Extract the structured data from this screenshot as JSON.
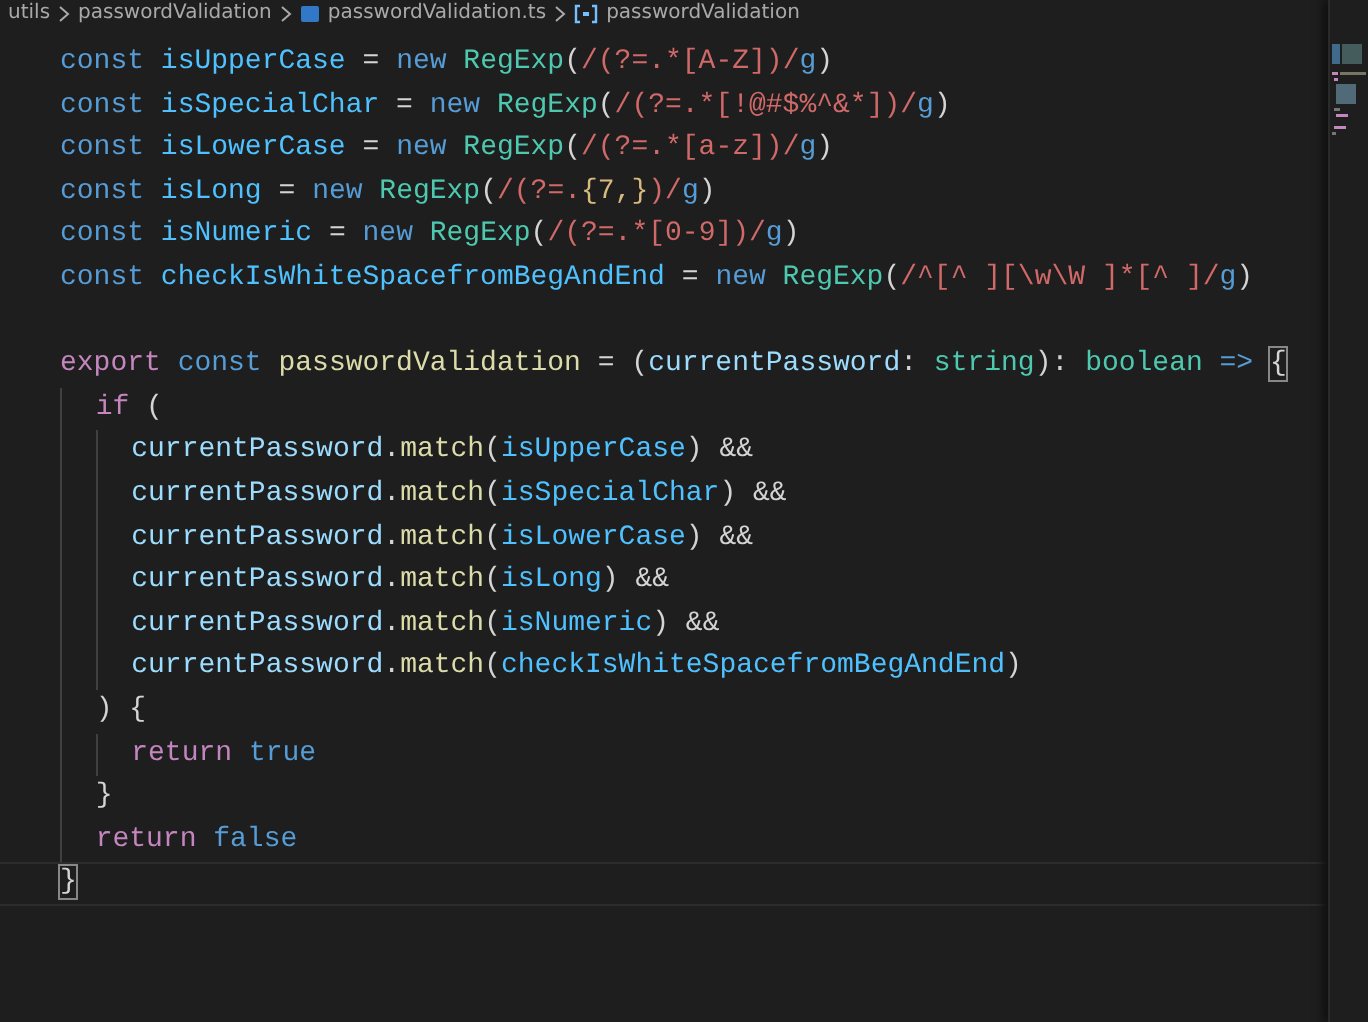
{
  "breadcrumbs": [
    {
      "kind": "folder",
      "label": "utils"
    },
    {
      "kind": "folder",
      "label": "passwordValidation"
    },
    {
      "kind": "file",
      "label": "passwordValidation.ts"
    },
    {
      "kind": "symbol",
      "label": "passwordValidation"
    }
  ],
  "code_lines": [
    {
      "current": false,
      "tokens": [
        {
          "kind": "kw",
          "text": "const "
        },
        {
          "kind": "const",
          "text": "isUpperCase"
        },
        {
          "kind": "plain",
          "text": " = "
        },
        {
          "kind": "kw",
          "text": "new "
        },
        {
          "kind": "type",
          "text": "RegExp"
        },
        {
          "kind": "plain",
          "text": "("
        },
        {
          "kind": "regex",
          "text": "/(?=.*[A-Z])/"
        },
        {
          "kind": "kw",
          "text": "g"
        },
        {
          "kind": "plain",
          "text": ")"
        }
      ]
    },
    {
      "current": false,
      "tokens": [
        {
          "kind": "kw",
          "text": "const "
        },
        {
          "kind": "const",
          "text": "isSpecialChar"
        },
        {
          "kind": "plain",
          "text": " = "
        },
        {
          "kind": "kw",
          "text": "new "
        },
        {
          "kind": "type",
          "text": "RegExp"
        },
        {
          "kind": "plain",
          "text": "("
        },
        {
          "kind": "regex",
          "text": "/(?=.*[!@#$%^&*])/"
        },
        {
          "kind": "kw",
          "text": "g"
        },
        {
          "kind": "plain",
          "text": ")"
        }
      ]
    },
    {
      "current": false,
      "tokens": [
        {
          "kind": "kw",
          "text": "const "
        },
        {
          "kind": "const",
          "text": "isLowerCase"
        },
        {
          "kind": "plain",
          "text": " = "
        },
        {
          "kind": "kw",
          "text": "new "
        },
        {
          "kind": "type",
          "text": "RegExp"
        },
        {
          "kind": "plain",
          "text": "("
        },
        {
          "kind": "regex",
          "text": "/(?=.*[a-z])/"
        },
        {
          "kind": "kw",
          "text": "g"
        },
        {
          "kind": "plain",
          "text": ")"
        }
      ]
    },
    {
      "current": false,
      "tokens": [
        {
          "kind": "kw",
          "text": "const "
        },
        {
          "kind": "const",
          "text": "isLong"
        },
        {
          "kind": "plain",
          "text": " = "
        },
        {
          "kind": "kw",
          "text": "new "
        },
        {
          "kind": "type",
          "text": "RegExp"
        },
        {
          "kind": "plain",
          "text": "("
        },
        {
          "kind": "regex",
          "text": "/(?=."
        },
        {
          "kind": "quant",
          "text": "{7,}"
        },
        {
          "kind": "regex",
          "text": ")/"
        },
        {
          "kind": "kw",
          "text": "g"
        },
        {
          "kind": "plain",
          "text": ")"
        }
      ]
    },
    {
      "current": false,
      "tokens": [
        {
          "kind": "kw",
          "text": "const "
        },
        {
          "kind": "const",
          "text": "isNumeric"
        },
        {
          "kind": "plain",
          "text": " = "
        },
        {
          "kind": "kw",
          "text": "new "
        },
        {
          "kind": "type",
          "text": "RegExp"
        },
        {
          "kind": "plain",
          "text": "("
        },
        {
          "kind": "regex",
          "text": "/(?=.*[0-9])/"
        },
        {
          "kind": "kw",
          "text": "g"
        },
        {
          "kind": "plain",
          "text": ")"
        }
      ]
    },
    {
      "current": false,
      "tokens": [
        {
          "kind": "kw",
          "text": "const "
        },
        {
          "kind": "const",
          "text": "checkIsWhiteSpacefromBegAndEnd"
        },
        {
          "kind": "plain",
          "text": " = "
        },
        {
          "kind": "kw",
          "text": "new "
        },
        {
          "kind": "type",
          "text": "RegExp"
        },
        {
          "kind": "plain",
          "text": "("
        },
        {
          "kind": "regex",
          "text": "/^[^ ][\\w\\W ]*[^ ]/"
        },
        {
          "kind": "kw",
          "text": "g"
        },
        {
          "kind": "plain",
          "text": ")"
        }
      ]
    },
    {
      "current": false
    },
    {
      "current": false,
      "tokens": [
        {
          "kind": "ctrl",
          "text": "export "
        },
        {
          "kind": "kw",
          "text": "const "
        },
        {
          "kind": "fn",
          "text": "passwordValidation"
        },
        {
          "kind": "plain",
          "text": " = ("
        },
        {
          "kind": "var",
          "text": "currentPassword"
        },
        {
          "kind": "plain",
          "text": ": "
        },
        {
          "kind": "type",
          "text": "string"
        },
        {
          "kind": "plain",
          "text": "): "
        },
        {
          "kind": "type",
          "text": "boolean "
        },
        {
          "kind": "kw",
          "text": "=> "
        },
        {
          "kind": "bracket",
          "text": "{"
        }
      ]
    },
    {
      "current": false,
      "tokens": [
        {
          "kind": "ctrl",
          "text": "  if"
        },
        {
          "kind": "plain",
          "text": " ("
        }
      ]
    },
    {
      "current": false,
      "tokens": [
        {
          "kind": "var",
          "text": "    currentPassword"
        },
        {
          "kind": "plain",
          "text": "."
        },
        {
          "kind": "fn",
          "text": "match"
        },
        {
          "kind": "plain",
          "text": "("
        },
        {
          "kind": "const",
          "text": "isUpperCase"
        },
        {
          "kind": "plain",
          "text": ") &&"
        }
      ]
    },
    {
      "current": false,
      "tokens": [
        {
          "kind": "var",
          "text": "    currentPassword"
        },
        {
          "kind": "plain",
          "text": "."
        },
        {
          "kind": "fn",
          "text": "match"
        },
        {
          "kind": "plain",
          "text": "("
        },
        {
          "kind": "const",
          "text": "isSpecialChar"
        },
        {
          "kind": "plain",
          "text": ") &&"
        }
      ]
    },
    {
      "current": false,
      "tokens": [
        {
          "kind": "var",
          "text": "    currentPassword"
        },
        {
          "kind": "plain",
          "text": "."
        },
        {
          "kind": "fn",
          "text": "match"
        },
        {
          "kind": "plain",
          "text": "("
        },
        {
          "kind": "const",
          "text": "isLowerCase"
        },
        {
          "kind": "plain",
          "text": ") &&"
        }
      ]
    },
    {
      "current": false,
      "tokens": [
        {
          "kind": "var",
          "text": "    currentPassword"
        },
        {
          "kind": "plain",
          "text": "."
        },
        {
          "kind": "fn",
          "text": "match"
        },
        {
          "kind": "plain",
          "text": "("
        },
        {
          "kind": "const",
          "text": "isLong"
        },
        {
          "kind": "plain",
          "text": ") &&"
        }
      ]
    },
    {
      "current": false,
      "tokens": [
        {
          "kind": "var",
          "text": "    currentPassword"
        },
        {
          "kind": "plain",
          "text": "."
        },
        {
          "kind": "fn",
          "text": "match"
        },
        {
          "kind": "plain",
          "text": "("
        },
        {
          "kind": "const",
          "text": "isNumeric"
        },
        {
          "kind": "plain",
          "text": ") &&"
        }
      ]
    },
    {
      "current": false,
      "tokens": [
        {
          "kind": "var",
          "text": "    currentPassword"
        },
        {
          "kind": "plain",
          "text": "."
        },
        {
          "kind": "fn",
          "text": "match"
        },
        {
          "kind": "plain",
          "text": "("
        },
        {
          "kind": "const",
          "text": "checkIsWhiteSpacefromBegAndEnd"
        },
        {
          "kind": "plain",
          "text": ")"
        }
      ]
    },
    {
      "current": false,
      "tokens": [
        {
          "kind": "plain",
          "text": "  ) {"
        }
      ]
    },
    {
      "current": false,
      "tokens": [
        {
          "kind": "ctrl",
          "text": "    return "
        },
        {
          "kind": "kw",
          "text": "true"
        }
      ]
    },
    {
      "current": false,
      "tokens": [
        {
          "kind": "plain",
          "text": "  }"
        }
      ]
    },
    {
      "current": false,
      "tokens": [
        {
          "kind": "ctrl",
          "text": "  return "
        },
        {
          "kind": "kw",
          "text": "false"
        }
      ]
    },
    {
      "current": true,
      "tokens": [
        {
          "kind": "bracket",
          "text": "}"
        }
      ]
    }
  ]
}
